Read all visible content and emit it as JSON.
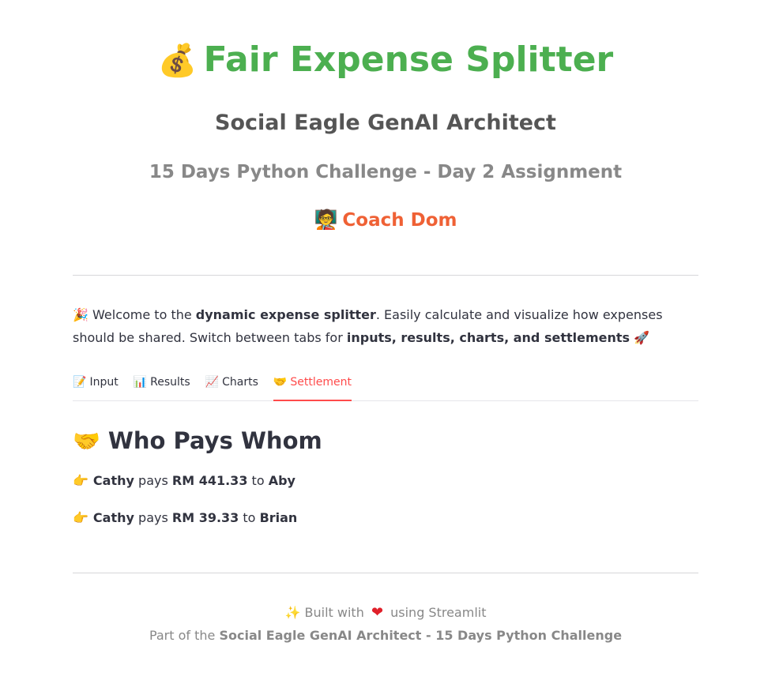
{
  "header": {
    "title_icon": "💰",
    "title": "Fair Expense Splitter",
    "subtitle": "Social Eagle GenAI Architect",
    "challenge": "15 Days Python Challenge - Day 2 Assignment",
    "coach_icon": "🧑‍🏫",
    "coach": "Coach Dom"
  },
  "intro": {
    "icon": "🎉",
    "text_1": "Welcome to the ",
    "bold_1": "dynamic expense splitter",
    "text_2": ". Easily calculate and visualize how expenses should be shared. Switch between tabs for ",
    "bold_2": "inputs, results, charts, and settlements",
    "end_icon": "🚀"
  },
  "tabs": [
    {
      "icon": "📝",
      "label": "Input"
    },
    {
      "icon": "📊",
      "label": "Results"
    },
    {
      "icon": "📈",
      "label": "Charts"
    },
    {
      "icon": "🤝",
      "label": "Settlement"
    }
  ],
  "active_tab": "Settlement",
  "settlement": {
    "title_icon": "🤝",
    "title": "Who Pays Whom",
    "rows": [
      {
        "icon": "👉",
        "payer": "Cathy",
        "verb": "pays",
        "amount": "RM 441.33",
        "to": "to",
        "payee": "Aby"
      },
      {
        "icon": "👉",
        "payer": "Cathy",
        "verb": "pays",
        "amount": "RM 39.33",
        "to": "to",
        "payee": "Brian"
      }
    ]
  },
  "footer": {
    "icon": "✨",
    "built_with": "Built with",
    "heart": "❤",
    "using": "using Streamlit",
    "part_of": "Part of the",
    "part_bold": "Social Eagle GenAI Architect - 15 Days Python Challenge"
  },
  "colors": {
    "title": "#4caf50",
    "coach": "#ef6135",
    "accent": "#ff4b4b"
  }
}
